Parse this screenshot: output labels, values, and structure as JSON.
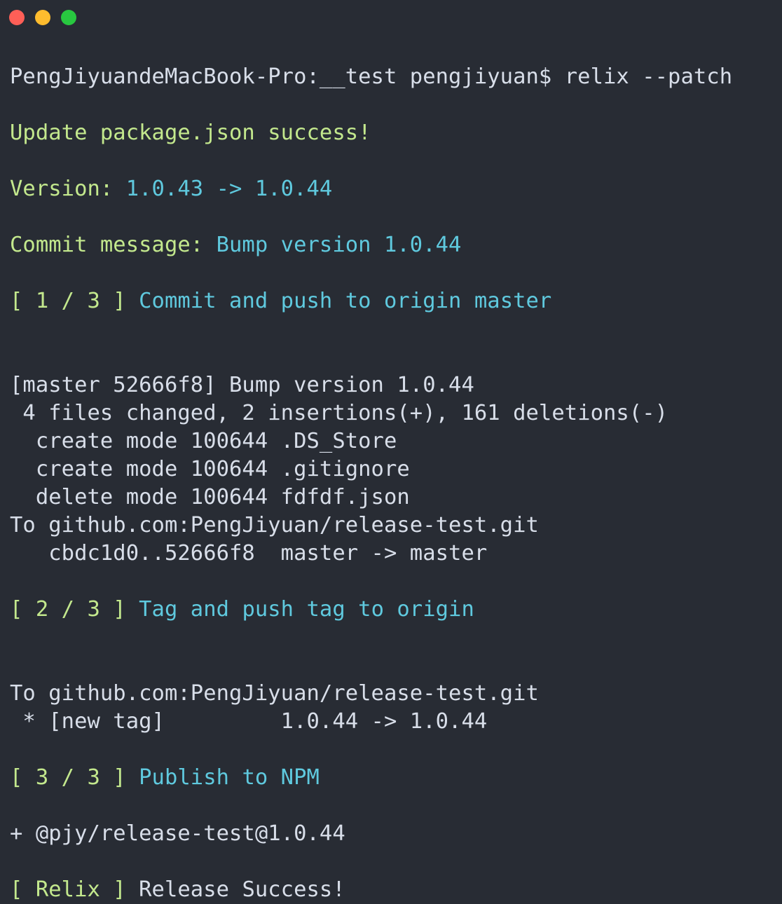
{
  "window": {
    "background_color": "#282c34",
    "buttons": [
      {
        "name": "close",
        "label": "",
        "color": "#ff5f57"
      },
      {
        "name": "minimize",
        "label": "",
        "color": "#febc2e"
      },
      {
        "name": "maximize",
        "label": "",
        "color": "#28c840"
      }
    ]
  },
  "colors": {
    "white": "#d8dee9",
    "green": "#c3e88d",
    "cyan": "#5fc9de"
  },
  "terminal": {
    "prompt": {
      "host_user": "PengJiyuandeMacBook-Pro:__test pengjiyuan$ ",
      "command": "relix --patch"
    },
    "lines": [
      {
        "type": "blank",
        "segments": [
          {
            "text": " ",
            "color": "white"
          }
        ]
      },
      {
        "type": "output",
        "segments": [
          {
            "text": "PengJiyuandeMacBook-Pro:__test pengjiyuan$ relix --patch",
            "color": "white"
          }
        ]
      },
      {
        "type": "blank",
        "segments": [
          {
            "text": " ",
            "color": "white"
          }
        ]
      },
      {
        "type": "output",
        "segments": [
          {
            "text": "Update package.json success!",
            "color": "green"
          }
        ]
      },
      {
        "type": "blank",
        "segments": [
          {
            "text": " ",
            "color": "white"
          }
        ]
      },
      {
        "type": "output",
        "segments": [
          {
            "text": "Version: ",
            "color": "green"
          },
          {
            "text": "1.0.43 -> 1.0.44",
            "color": "cyan"
          }
        ]
      },
      {
        "type": "blank",
        "segments": [
          {
            "text": " ",
            "color": "white"
          }
        ]
      },
      {
        "type": "output",
        "segments": [
          {
            "text": "Commit message: ",
            "color": "green"
          },
          {
            "text": "Bump version 1.0.44",
            "color": "cyan"
          }
        ]
      },
      {
        "type": "blank",
        "segments": [
          {
            "text": " ",
            "color": "white"
          }
        ]
      },
      {
        "type": "output",
        "segments": [
          {
            "text": "[ 1 / 3 ] ",
            "color": "green"
          },
          {
            "text": "Commit and push to origin master",
            "color": "cyan"
          }
        ]
      },
      {
        "type": "blank",
        "segments": [
          {
            "text": " ",
            "color": "white"
          }
        ]
      },
      {
        "type": "blank",
        "segments": [
          {
            "text": " ",
            "color": "white"
          }
        ]
      },
      {
        "type": "output",
        "segments": [
          {
            "text": "[master 52666f8] Bump version 1.0.44",
            "color": "white"
          }
        ]
      },
      {
        "type": "output",
        "segments": [
          {
            "text": " 4 files changed, 2 insertions(+), 161 deletions(-)",
            "color": "white"
          }
        ]
      },
      {
        "type": "output",
        "segments": [
          {
            "text": "  create mode 100644 .DS_Store",
            "color": "white"
          }
        ]
      },
      {
        "type": "output",
        "segments": [
          {
            "text": "  create mode 100644 .gitignore",
            "color": "white"
          }
        ]
      },
      {
        "type": "output",
        "segments": [
          {
            "text": "  delete mode 100644 fdfdf.json",
            "color": "white"
          }
        ]
      },
      {
        "type": "output",
        "segments": [
          {
            "text": "To github.com:PengJiyuan/release-test.git",
            "color": "white"
          }
        ]
      },
      {
        "type": "output",
        "segments": [
          {
            "text": "   cbdc1d0..52666f8  master -> master",
            "color": "white"
          }
        ]
      },
      {
        "type": "blank",
        "segments": [
          {
            "text": " ",
            "color": "white"
          }
        ]
      },
      {
        "type": "output",
        "segments": [
          {
            "text": "[ 2 / 3 ] ",
            "color": "green"
          },
          {
            "text": "Tag and push tag to origin",
            "color": "cyan"
          }
        ]
      },
      {
        "type": "blank",
        "segments": [
          {
            "text": " ",
            "color": "white"
          }
        ]
      },
      {
        "type": "blank",
        "segments": [
          {
            "text": " ",
            "color": "white"
          }
        ]
      },
      {
        "type": "output",
        "segments": [
          {
            "text": "To github.com:PengJiyuan/release-test.git",
            "color": "white"
          }
        ]
      },
      {
        "type": "output",
        "segments": [
          {
            "text": " * [new tag]         1.0.44 -> 1.0.44",
            "color": "white"
          }
        ]
      },
      {
        "type": "blank",
        "segments": [
          {
            "text": " ",
            "color": "white"
          }
        ]
      },
      {
        "type": "output",
        "segments": [
          {
            "text": "[ 3 / 3 ] ",
            "color": "green"
          },
          {
            "text": "Publish to NPM",
            "color": "cyan"
          }
        ]
      },
      {
        "type": "blank",
        "segments": [
          {
            "text": " ",
            "color": "white"
          }
        ]
      },
      {
        "type": "output",
        "segments": [
          {
            "text": "+ @pjy/release-test@1.0.44",
            "color": "white"
          }
        ]
      },
      {
        "type": "blank",
        "segments": [
          {
            "text": " ",
            "color": "white"
          }
        ]
      },
      {
        "type": "output",
        "segments": [
          {
            "text": "[ Relix ] ",
            "color": "green"
          },
          {
            "text": "Release Success!",
            "color": "white"
          }
        ]
      }
    ]
  }
}
